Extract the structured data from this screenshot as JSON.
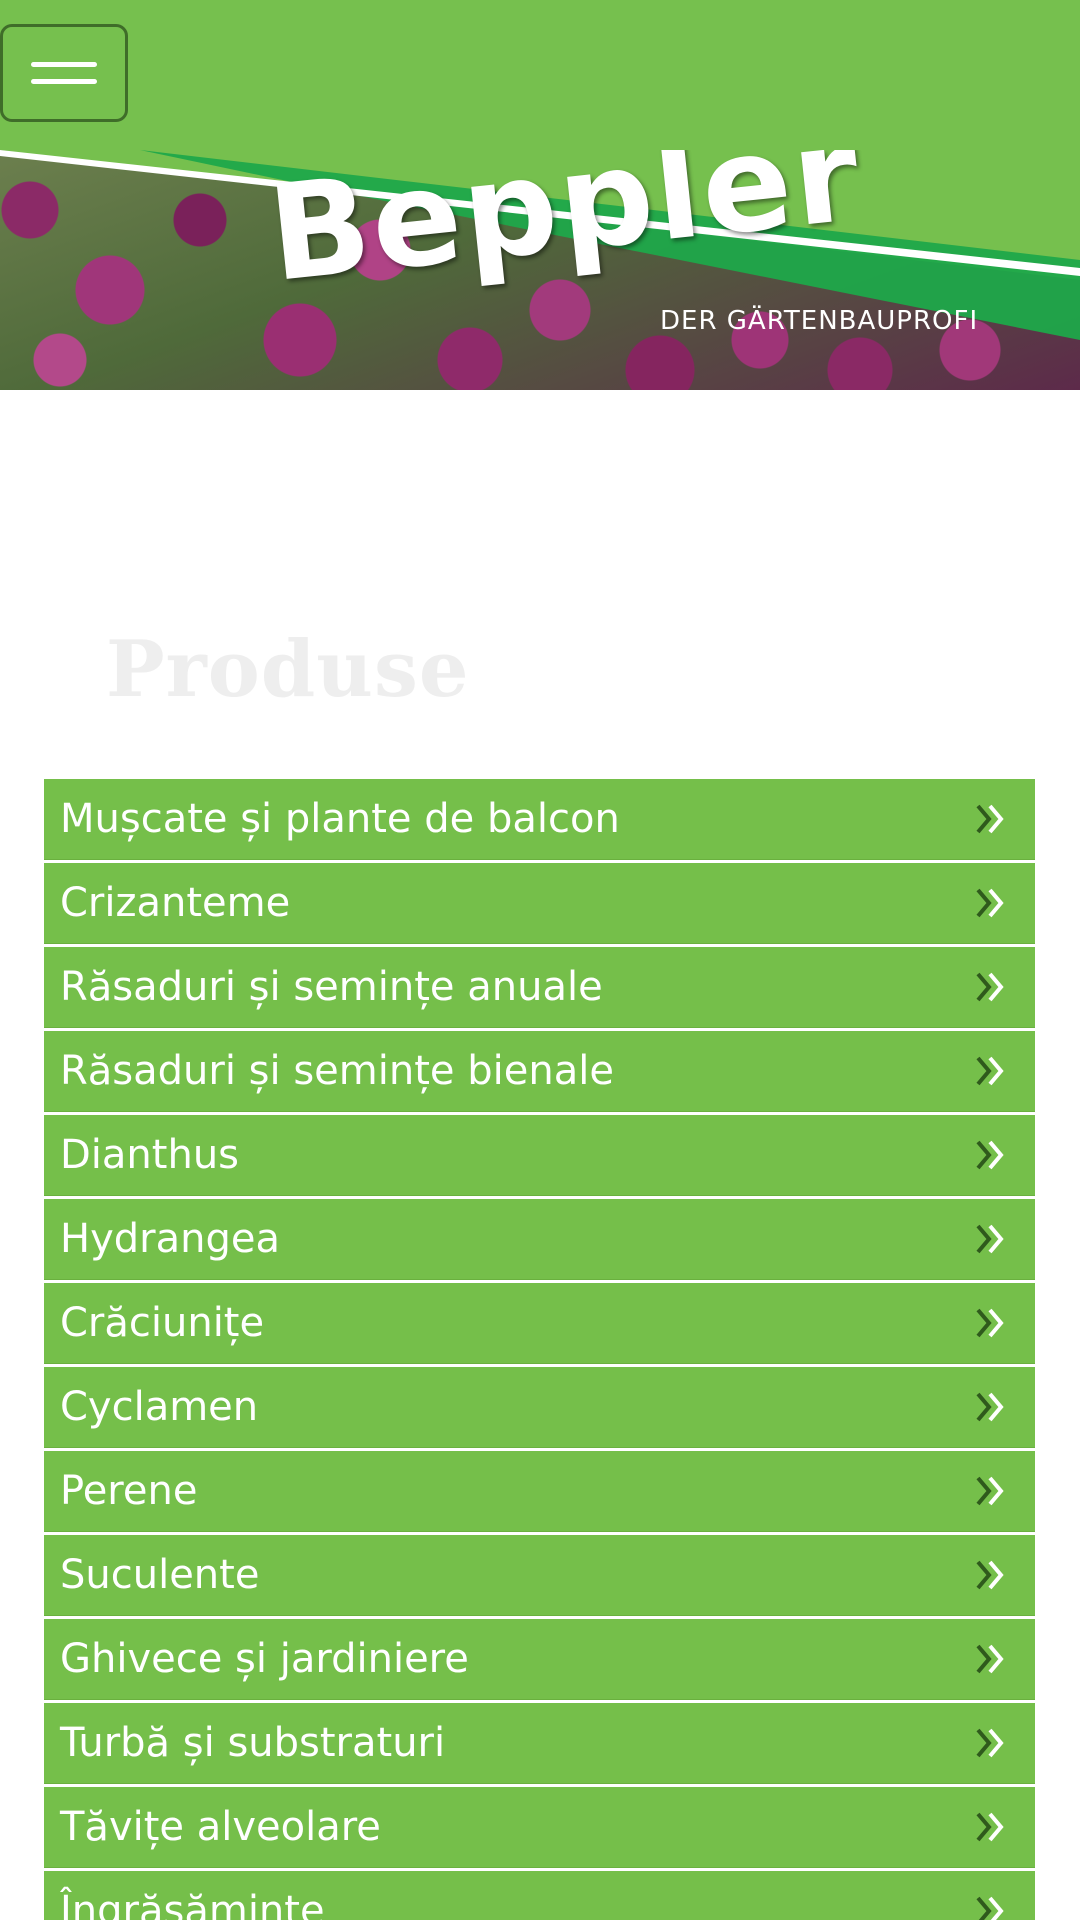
{
  "header": {
    "menu_button_icon": "hamburger-icon",
    "brand_name": "Beppler",
    "tagline": "DER GÄRTENBAUPROFI",
    "accent_color": "#76c04e"
  },
  "main": {
    "title": "Produse",
    "products": [
      {
        "label": "Mușcate și plante de balcon",
        "icon": "double-chevron-right-icon"
      },
      {
        "label": "Crizanteme",
        "icon": "double-chevron-right-icon"
      },
      {
        "label": "Răsaduri și semințe anuale",
        "icon": "double-chevron-right-icon"
      },
      {
        "label": "Răsaduri și semințe bienale",
        "icon": "double-chevron-right-icon"
      },
      {
        "label": "Dianthus",
        "icon": "double-chevron-right-icon"
      },
      {
        "label": "Hydrangea",
        "icon": "double-chevron-right-icon"
      },
      {
        "label": "Crăciunițe",
        "icon": "double-chevron-right-icon"
      },
      {
        "label": "Cyclamen",
        "icon": "double-chevron-right-icon"
      },
      {
        "label": "Perene",
        "icon": "double-chevron-right-icon"
      },
      {
        "label": "Suculente",
        "icon": "double-chevron-right-icon"
      },
      {
        "label": "Ghivece și jardiniere",
        "icon": "double-chevron-right-icon"
      },
      {
        "label": "Turbă și substraturi",
        "icon": "double-chevron-right-icon"
      },
      {
        "label": "Tăvițe alveolare",
        "icon": "double-chevron-right-icon"
      },
      {
        "label": "Îngrășăminte",
        "icon": "double-chevron-right-icon"
      }
    ]
  }
}
